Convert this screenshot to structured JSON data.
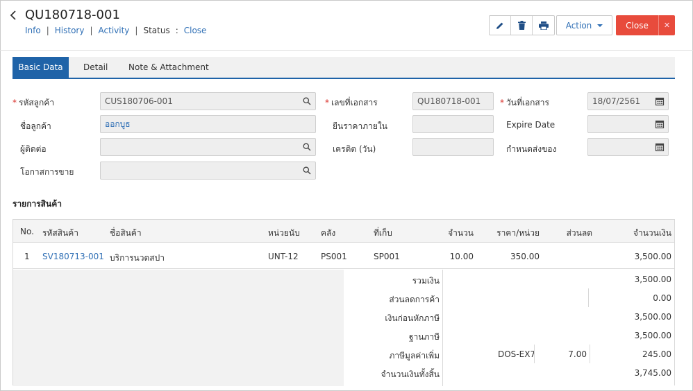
{
  "header": {
    "title": "QU180718-001",
    "nav": {
      "info": "Info",
      "history": "History",
      "activity": "Activity",
      "status_label": "Status",
      "status_value": "Close"
    },
    "action_label": "Action",
    "close_label": "Close"
  },
  "tabs": [
    "Basic Data",
    "Detail",
    "Note & Attachment"
  ],
  "form": {
    "customer_code": {
      "label": "รหัสลูกค้า",
      "value": "CUS180706-001"
    },
    "customer_name": {
      "label": "ชื่อลูกค้า",
      "value": "ออกบูธ"
    },
    "contact": {
      "label": "ผู้ติดต่อ",
      "value": ""
    },
    "sales_opportunity": {
      "label": "โอกาสการขาย",
      "value": ""
    },
    "doc_no": {
      "label": "เลขที่เอกสาร",
      "value": "QU180718-001"
    },
    "price_hold": {
      "label": "ยืนราคาภายใน",
      "value": ""
    },
    "credit_days": {
      "label": "เครดิต (วัน)",
      "value": ""
    },
    "doc_date": {
      "label": "วันที่เอกสาร",
      "value": "18/07/2561"
    },
    "expire_date": {
      "label": "Expire Date",
      "value": ""
    },
    "delivery_date": {
      "label": "กำหนดส่งของ",
      "value": ""
    }
  },
  "items_section_title": "รายการสินค้า",
  "table": {
    "columns": [
      "No.",
      "รหัสสินค้า",
      "ชื่อสินค้า",
      "หน่วยนับ",
      "คลัง",
      "ที่เก็บ",
      "จำนวน",
      "ราคา/หน่วย",
      "ส่วนลด",
      "จำนวนเงิน"
    ],
    "rows": [
      {
        "no": "1",
        "code": "SV180713-001",
        "name": "บริการนวดสปา",
        "unit": "UNT-12",
        "warehouse": "PS001",
        "location": "SP001",
        "qty": "10.00",
        "price": "350.00",
        "discount": "",
        "amount": "3,500.00"
      }
    ]
  },
  "summary": {
    "total": {
      "label": "รวมเงิน",
      "value": "3,500.00"
    },
    "trade_discount": {
      "label": "ส่วนลดการค้า",
      "value": "0.00"
    },
    "before_tax": {
      "label": "เงินก่อนหักภาษี",
      "value": "3,500.00"
    },
    "tax_base": {
      "label": "ฐานภาษี",
      "value": "3,500.00"
    },
    "vat": {
      "label": "ภาษีมูลค่าเพิ่ม",
      "code": "DOS-EX7",
      "rate": "7.00",
      "value": "245.00"
    },
    "grand_total": {
      "label": "จำนวนเงินทั้งสิ้น",
      "value": "3,745.00"
    }
  },
  "colors": {
    "primary": "#1f63a8",
    "link": "#2f6fb5",
    "danger": "#e84b3c",
    "required": "#d9312b"
  }
}
